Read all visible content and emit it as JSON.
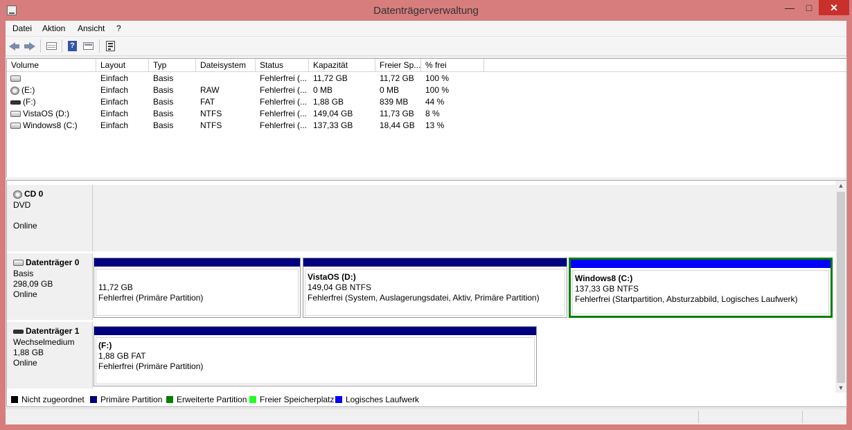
{
  "window": {
    "title": "Datenträgerverwaltung"
  },
  "menu": [
    "Datei",
    "Aktion",
    "Ansicht",
    "?"
  ],
  "toolbar": {
    "icons": [
      "back-icon",
      "forward-icon",
      "volume-list-icon",
      "help-icon",
      "disk-view-icon",
      "properties-icon"
    ]
  },
  "volume_list": {
    "columns": [
      "Volume",
      "Layout",
      "Typ",
      "Dateisystem",
      "Status",
      "Kapazität",
      "Freier Sp...",
      "% frei"
    ],
    "rows": [
      {
        "volume": "",
        "icon": "disk",
        "layout": "Einfach",
        "typ": "Basis",
        "dateisystem": "",
        "status": "Fehlerfrei (...",
        "kapazitaet": "11,72 GB",
        "frei": "11,72 GB",
        "prozent": "100 %"
      },
      {
        "volume": "(E:)",
        "icon": "cd",
        "layout": "Einfach",
        "typ": "Basis",
        "dateisystem": "RAW",
        "status": "Fehlerfrei (...",
        "kapazitaet": "0 MB",
        "frei": "0 MB",
        "prozent": "100 %"
      },
      {
        "volume": "(F:)",
        "icon": "removable",
        "layout": "Einfach",
        "typ": "Basis",
        "dateisystem": "FAT",
        "status": "Fehlerfrei (...",
        "kapazitaet": "1,88 GB",
        "frei": "839 MB",
        "prozent": "44 %"
      },
      {
        "volume": "VistaOS (D:)",
        "icon": "disk",
        "layout": "Einfach",
        "typ": "Basis",
        "dateisystem": "NTFS",
        "status": "Fehlerfrei (...",
        "kapazitaet": "149,04 GB",
        "frei": "11,73 GB",
        "prozent": "8 %"
      },
      {
        "volume": "Windows8 (C:)",
        "icon": "disk",
        "layout": "Einfach",
        "typ": "Basis",
        "dateisystem": "NTFS",
        "status": "Fehlerfrei (...",
        "kapazitaet": "137,33 GB",
        "frei": "18,44 GB",
        "prozent": "13 %"
      }
    ]
  },
  "disks": [
    {
      "name": "CD 0",
      "type": "DVD",
      "size": "",
      "state": "Online",
      "icon": "cd",
      "volumes": []
    },
    {
      "name": "Datenträger 0",
      "type": "Basis",
      "size": "298,09 GB",
      "state": "Online",
      "icon": "disk",
      "volumes": [
        {
          "title": "",
          "size": "11,72 GB",
          "status": "Fehlerfrei (Primäre Partition)",
          "kind": "primary",
          "selected": false
        },
        {
          "title": "VistaOS  (D:)",
          "size": "149,04 GB NTFS",
          "status": "Fehlerfrei (System, Auslagerungsdatei, Aktiv, Primäre Partition)",
          "kind": "primary",
          "selected": false
        },
        {
          "title": "Windows8  (C:)",
          "size": "137,33 GB NTFS",
          "status": "Fehlerfrei (Startpartition, Absturzabbild, Logisches Laufwerk)",
          "kind": "logical",
          "selected": true
        }
      ]
    },
    {
      "name": "Datenträger 1",
      "type": "Wechselmedium",
      "size": "1,88 GB",
      "state": "Online",
      "icon": "removable",
      "volumes": [
        {
          "title": "(F:)",
          "size": "1,88 GB FAT",
          "status": "Fehlerfrei (Primäre Partition)",
          "kind": "primary",
          "selected": false
        }
      ]
    }
  ],
  "legend": [
    {
      "label": "Nicht zugeordnet",
      "color": "#000000"
    },
    {
      "label": "Primäre Partition",
      "color": "#00007f"
    },
    {
      "label": "Erweiterte Partition",
      "color": "#007f00"
    },
    {
      "label": "Freier Speicherplatz",
      "color": "#20ff20"
    },
    {
      "label": "Logisches Laufwerk",
      "color": "#0000ff"
    }
  ]
}
